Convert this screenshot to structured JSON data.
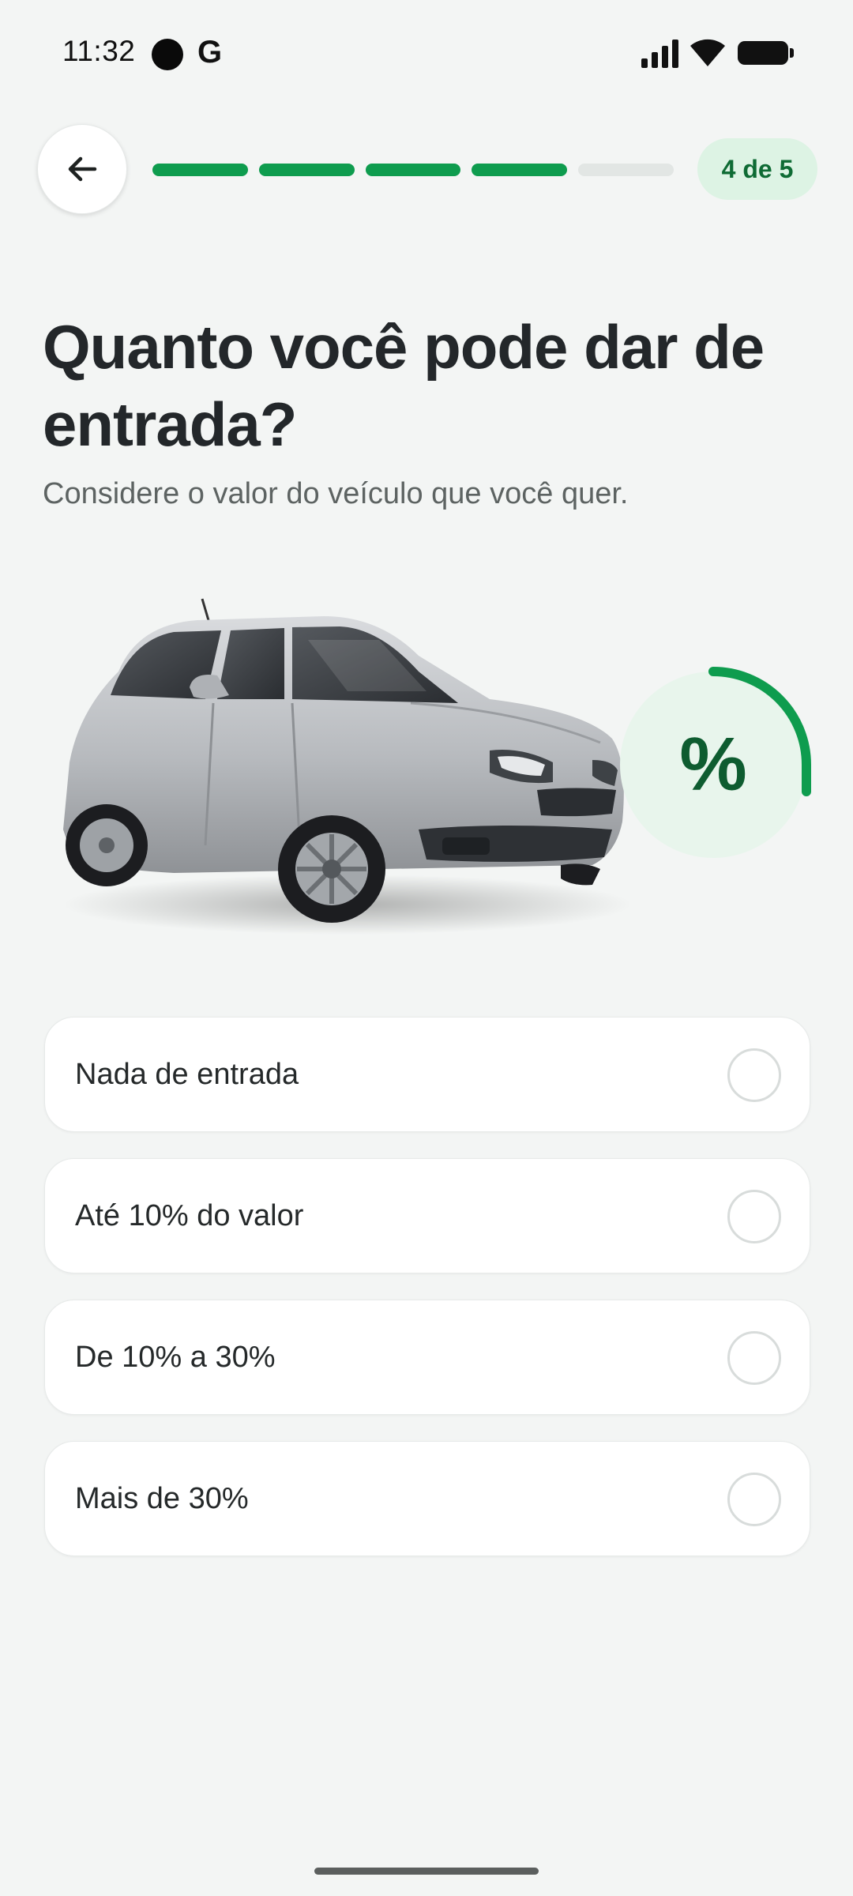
{
  "status_bar": {
    "time": "11:32",
    "notification_letter": "G",
    "icons": [
      "circle-notification-icon",
      "google-icon",
      "signal-icon",
      "wifi-icon",
      "battery-icon"
    ]
  },
  "header": {
    "back_icon": "arrow-left-icon",
    "progress": {
      "current": 4,
      "total": 5
    },
    "step_label": "4 de 5",
    "accent_color": "#0E9C4E",
    "badge_bg": "#DDF3E4"
  },
  "question": {
    "title": "Quanto você pode dar de entrada?",
    "subtitle": "Considere o valor do veículo que você quer."
  },
  "illustration": {
    "image": "silver-hatchback-car",
    "badge_symbol": "%"
  },
  "options": [
    {
      "label": "Nada de entrada",
      "selected": false
    },
    {
      "label": "Até 10% do valor",
      "selected": false
    },
    {
      "label": "De 10% a 30%",
      "selected": false
    },
    {
      "label": "Mais de 30%",
      "selected": false
    }
  ]
}
